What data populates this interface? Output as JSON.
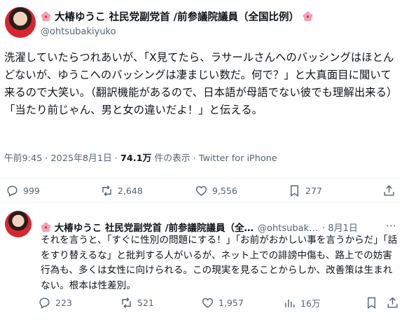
{
  "colors": {
    "text": "#0f1419",
    "secondary": "#536471",
    "divider": "#eff3f4"
  },
  "main": {
    "author": {
      "name": "大椿ゆうこ 社民党副党首 /前参議院議員（全国比例）",
      "handle": "@ohtsubakiyuko"
    },
    "text": "洗濯していたらつれあいが、「X見てたら、ラサールさんへのバッシングはほとんどないが、ゆうこへのバッシングは凄まじい数だ。何で？」と大真面目に聞いて来るので大笑い。（翻訳機能があるので、日本語が母語でない彼でも理解出来る）「当たり前じゃん、男と女の違いだよ！」と伝える。",
    "time": "午前9:45 · 2025年8月1日 · ",
    "views": "74.1万",
    "views_label": " 件の表示 · ",
    "source": "Twitter for iPhone",
    "actions": {
      "replies": "999",
      "reposts": "2,648",
      "likes": "9,556",
      "bookmarks": "277"
    }
  },
  "reply": {
    "author": {
      "name": "大椿ゆうこ 社民党副党首 /前参議院議員（全…",
      "handle": "@ohtsubak…",
      "date": "· 8月1日"
    },
    "text": "それを言うと、「すぐに性別の問題にする！」「お前がおかしい事を言うからだ」「話をすり替えるな」と批判する人がいるが、ネット上での誹謗中傷も、路上での妨害行為も、多くは女性に向けられる。この現実を見ることからしか、改善策は生まれない。根本は性差別。",
    "actions": {
      "replies": "223",
      "reposts": "521",
      "likes": "1,957",
      "views": "16万"
    }
  },
  "icons": [
    "hibiscus-icon",
    "reply-icon",
    "repost-icon",
    "like-icon",
    "bookmark-icon",
    "views-icon",
    "share-icon",
    "more-icon"
  ]
}
